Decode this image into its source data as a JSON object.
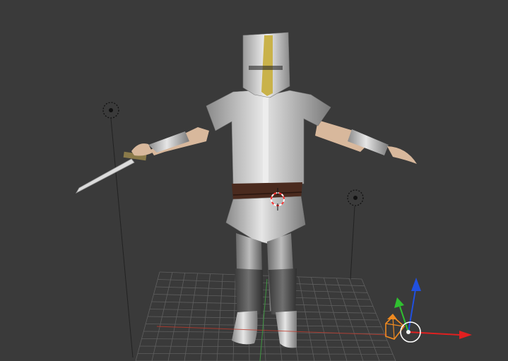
{
  "viewport": {
    "background": "#3a3a3a",
    "grid_color": "#5f5f5f",
    "x_axis_color": "#c0392b",
    "y_axis_color": "#3fa142",
    "armor_color": "#c8c8c8",
    "helmet_stripe_color": "#c9b24a",
    "belt_color": "#4a2a1e",
    "skin_color": "#d8b89c",
    "sword_blade_color": "#dcdcdc",
    "sword_hilt_color": "#8a7a4a"
  },
  "lamps": [
    {
      "name": "lamp-left"
    },
    {
      "name": "lamp-right"
    }
  ],
  "cursor_3d": {
    "name": "3d-cursor",
    "color_a": "#ff3333",
    "color_b": "#ffffff"
  },
  "gizmo": {
    "x_color": "#e02020",
    "y_color": "#30c030",
    "z_color": "#2050e0",
    "camera_color": "#f08a20",
    "view_ring_color": "#ffffff"
  }
}
